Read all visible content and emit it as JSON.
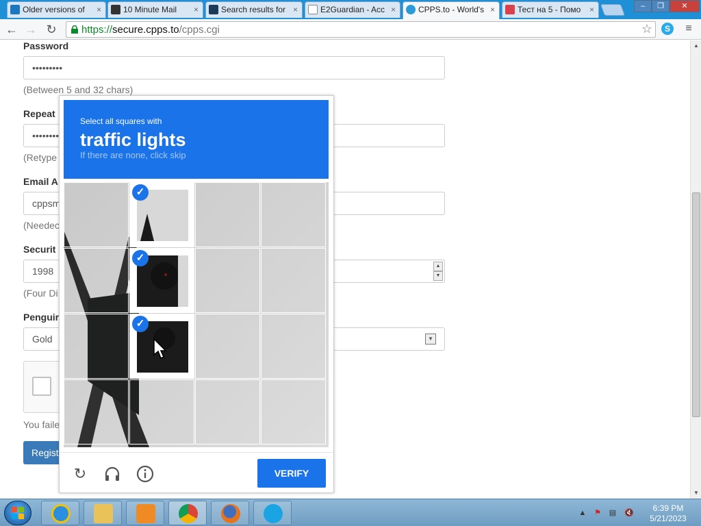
{
  "browser": {
    "tabs": [
      {
        "label": "Older versions of",
        "active": false
      },
      {
        "label": "10 Minute Mail",
        "active": false
      },
      {
        "label": "Search results for",
        "active": false
      },
      {
        "label": "E2Guardian - Acc",
        "active": false
      },
      {
        "label": "CPPS.to - World's",
        "active": true
      },
      {
        "label": "Тест на 5 - Помо",
        "active": false
      }
    ],
    "tab_close": "×",
    "url_scheme": "https://",
    "url_host": "secure.cpps.to",
    "url_path": "/cpps.cgi",
    "window_controls": [
      "–",
      "❐",
      "✕"
    ]
  },
  "form": {
    "password_label": "Password",
    "password_value": "•••••••••",
    "password_help": "(Between 5 and 32 chars)",
    "repeat_label": "Repeat",
    "repeat_value": "•••••••••",
    "repeat_help": "(Retype",
    "email_label": "Email A",
    "email_value": "cppsm",
    "email_help": "(Needec",
    "security_label": "Securit",
    "security_value": "1998",
    "security_help": "(Four Di",
    "penguin_label": "Penguir",
    "penguin_value": "Gold",
    "fail_text": "You faile",
    "register_label": "Regist"
  },
  "captcha": {
    "line1": "Select all squares with",
    "line2": "traffic lights",
    "line3": "If there are none, click skip",
    "verify_label": "VERIFY",
    "selected_cells": [
      1,
      5,
      9
    ],
    "icons": [
      "reload-icon",
      "audio-icon",
      "info-icon"
    ]
  },
  "taskbar": {
    "apps": [
      "internet-explorer-icon",
      "file-explorer-icon",
      "media-player-icon",
      "chrome-icon",
      "firefox-icon",
      "skype-icon"
    ],
    "time": "6:39 PM",
    "date": "5/21/2023"
  },
  "colors": {
    "captcha_blue": "#1a73e8",
    "register_blue": "#3a7ab8",
    "url_green": "#0a8a2a"
  }
}
